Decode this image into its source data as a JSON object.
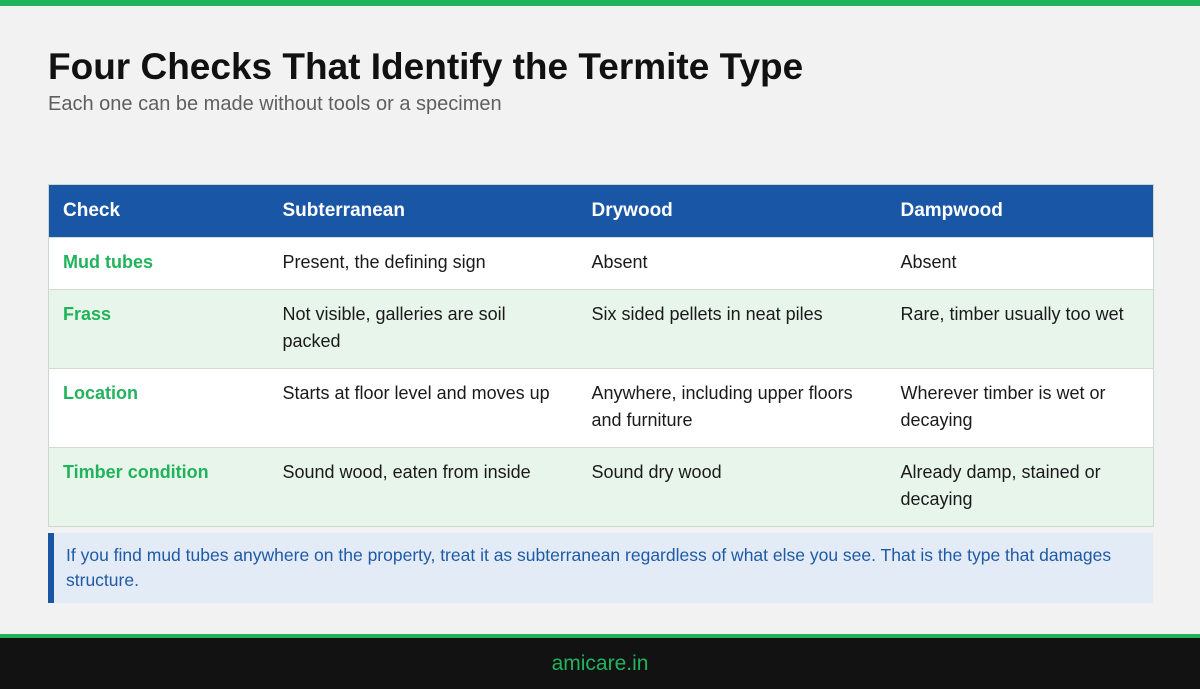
{
  "header": {
    "title": "Four Checks That Identify the Termite Type",
    "subtitle": "Each one can be made without tools or a specimen"
  },
  "table": {
    "columns": [
      "Check",
      "Subterranean",
      "Drywood",
      "Dampwood"
    ],
    "rows": [
      {
        "check": "Mud tubes",
        "subterranean": "Present, the defining sign",
        "drywood": "Absent",
        "dampwood": "Absent"
      },
      {
        "check": "Frass",
        "subterranean": "Not visible, galleries are soil packed",
        "drywood": "Six sided pellets in neat piles",
        "dampwood": "Rare, timber usually too wet"
      },
      {
        "check": "Location",
        "subterranean": "Starts at floor level and moves up",
        "drywood": "Anywhere, including upper floors and furniture",
        "dampwood": "Wherever timber is wet or decaying"
      },
      {
        "check": "Timber condition",
        "subterranean": "Sound wood, eaten from inside",
        "drywood": "Sound dry wood",
        "dampwood": "Already damp, stained or decaying"
      }
    ]
  },
  "callout": {
    "text": "If you find mud tubes anywhere on the property, treat it as subterranean regardless of what else you see. That is the type that damages structure."
  },
  "footer": {
    "site": "amicare.in"
  },
  "colors": {
    "accent_green": "#21b35c",
    "header_blue": "#1a56a6",
    "callout_bg": "#e3ebf6",
    "row_alt": "#e8f5ea",
    "footer_bg": "#121212"
  }
}
